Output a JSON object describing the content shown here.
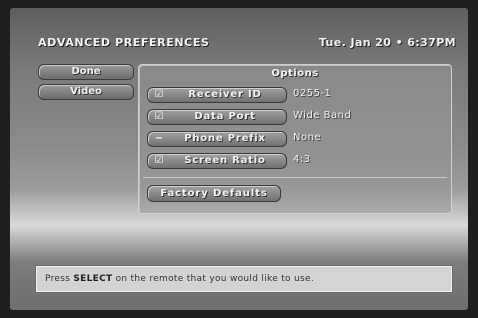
{
  "header": {
    "title": "ADVANCED PREFERENCES",
    "datetime": "Tue. Jan 20 • 6:37PM"
  },
  "nav": {
    "items": [
      {
        "label": "Done"
      },
      {
        "label": "Video"
      }
    ]
  },
  "options": {
    "title": "Options",
    "rows": [
      {
        "icon": "☑",
        "icon_name": "checkbox-icon",
        "label": "Receiver ID",
        "value": "0255-1"
      },
      {
        "icon": "☑",
        "icon_name": "checkbox-icon",
        "label": "Data Port",
        "value": "Wide Band"
      },
      {
        "icon": "−",
        "icon_name": "dash-icon",
        "label": "Phone Prefix",
        "value": "None"
      },
      {
        "icon": "☑",
        "icon_name": "checkbox-icon",
        "label": "Screen Ratio",
        "value": "4:3"
      }
    ],
    "factory_label": "Factory Defaults"
  },
  "help": {
    "prefix": "Press ",
    "key": "SELECT",
    "suffix": " on the remote that you would like to use."
  },
  "colors": {
    "background": "#1f1f1f",
    "panel": "#969696",
    "help_bar": "#d3d3d3"
  }
}
